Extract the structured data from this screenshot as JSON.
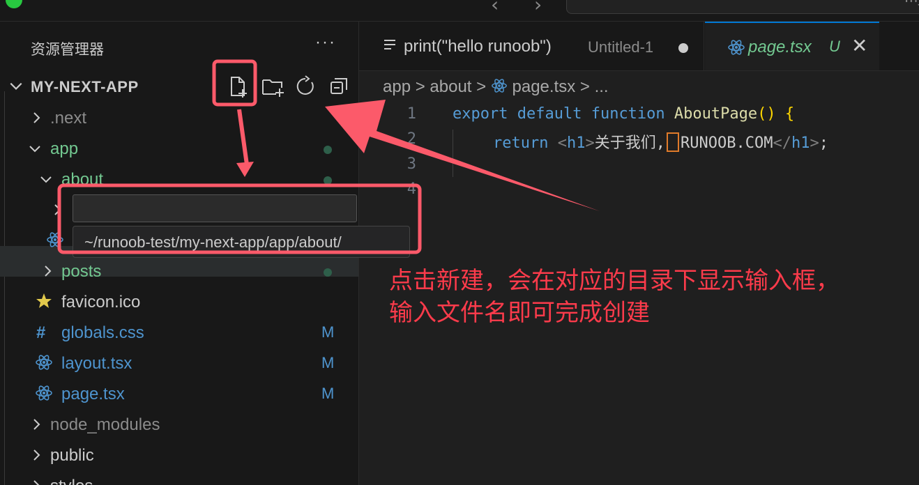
{
  "sidebar": {
    "title": "资源管理器",
    "more": "···",
    "project": "MY-NEXT-APP",
    "tree": [
      {
        "label": ".next",
        "color": "#8b8b8b",
        "chevron": "right"
      },
      {
        "label": "app",
        "color": "#73c991",
        "chevron": "down"
      },
      {
        "label": "about",
        "color": "#73c991",
        "chevron": "down"
      },
      {
        "label": "posts",
        "color": "#73c991",
        "chevron": "right"
      },
      {
        "label": "favicon.ico",
        "color": "#cccccc"
      },
      {
        "label": "globals.css",
        "color": "#4e94ce",
        "badge": "M"
      },
      {
        "label": "layout.tsx",
        "color": "#4e94ce",
        "badge": "M"
      },
      {
        "label": "page.tsx",
        "color": "#4e94ce",
        "badge": "M"
      },
      {
        "label": "node_modules",
        "color": "#8b8b8b",
        "chevron": "right"
      },
      {
        "label": "public",
        "color": "#cccccc",
        "chevron": "right"
      },
      {
        "label": "styles",
        "color": "#cccccc",
        "chevron": "right"
      }
    ]
  },
  "new_file": {
    "input_value": "",
    "path": "~/runoob-test/my-next-app/app/about/"
  },
  "titlebar": {
    "cmd_text": "my"
  },
  "tabs": [
    {
      "name": "print(\"hello runoob\")",
      "desc": "Untitled-1"
    },
    {
      "name": "page.tsx",
      "status": "U",
      "close": "✕"
    }
  ],
  "breadcrumb": {
    "parts": [
      "app",
      "about",
      "page.tsx",
      "..."
    ],
    "sep": ">"
  },
  "code": {
    "line_numbers": [
      "1",
      "2",
      "3",
      "4"
    ],
    "l1_kw1": "export",
    "l1_kw2": "default",
    "l1_kw3": "function",
    "l1_fn": "AboutPage",
    "l1_paren": "()",
    "l1_brace": "{",
    "l2_kw": "return",
    "l2_open": "<",
    "l2_tag": "h1",
    "l2_close": ">",
    "l2_text1": "关于我们",
    "l2_comma": ",",
    "l2_text2": "RUNOOB.COM",
    "l2_end_open": "</",
    "l2_end_tag": "h1",
    "l2_end_close": ">",
    "l2_semi": ";"
  },
  "callout": {
    "line1": "点击新建，会在对应的目录下显示输入框，",
    "line2": "输入文件名即可完成创建"
  },
  "colors": {
    "annotation": "#fc5a6a",
    "accent": "#0078d4",
    "untracked": "#73c991",
    "modified": "#4e94ce"
  }
}
